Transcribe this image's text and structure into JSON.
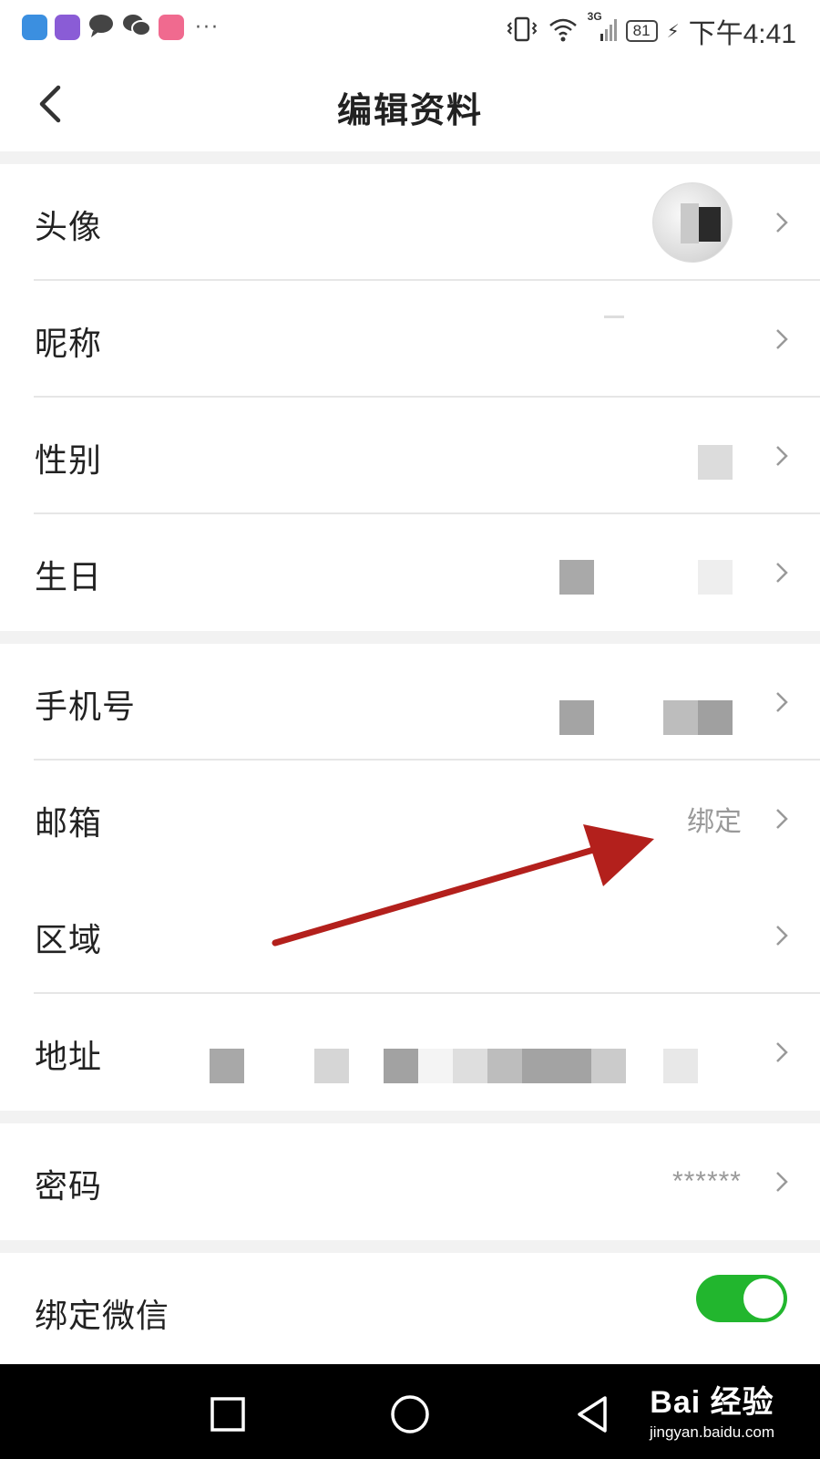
{
  "status_bar": {
    "time": "下午4:41",
    "battery": "81",
    "network": "3G",
    "app_icons": [
      "app-icon-1",
      "app-icon-2",
      "message-icon",
      "wechat-icon",
      "app-icon-5"
    ],
    "overflow": "···"
  },
  "header": {
    "title": "编辑资料",
    "back_icon": "chevron-left-icon"
  },
  "rows": {
    "avatar": {
      "label": "头像"
    },
    "nickname": {
      "label": "昵称"
    },
    "gender": {
      "label": "性别"
    },
    "birthday": {
      "label": "生日"
    },
    "phone": {
      "label": "手机号"
    },
    "email": {
      "label": "邮箱",
      "value": "绑定"
    },
    "region": {
      "label": "区域"
    },
    "address": {
      "label": "地址"
    },
    "password": {
      "label": "密码",
      "value": "******"
    },
    "bind_wechat": {
      "label": "绑定微信",
      "enabled": true
    }
  },
  "colors": {
    "toggle_on": "#22b62e",
    "annotation_arrow": "#b3201c",
    "section_gap": "#f2f2f2"
  },
  "nav_bar": {
    "buttons": [
      "recents-square-icon",
      "home-circle-icon",
      "back-triangle-icon"
    ]
  },
  "watermark": {
    "brand": "Bai 经验",
    "url": "jingyan.baidu.com"
  }
}
